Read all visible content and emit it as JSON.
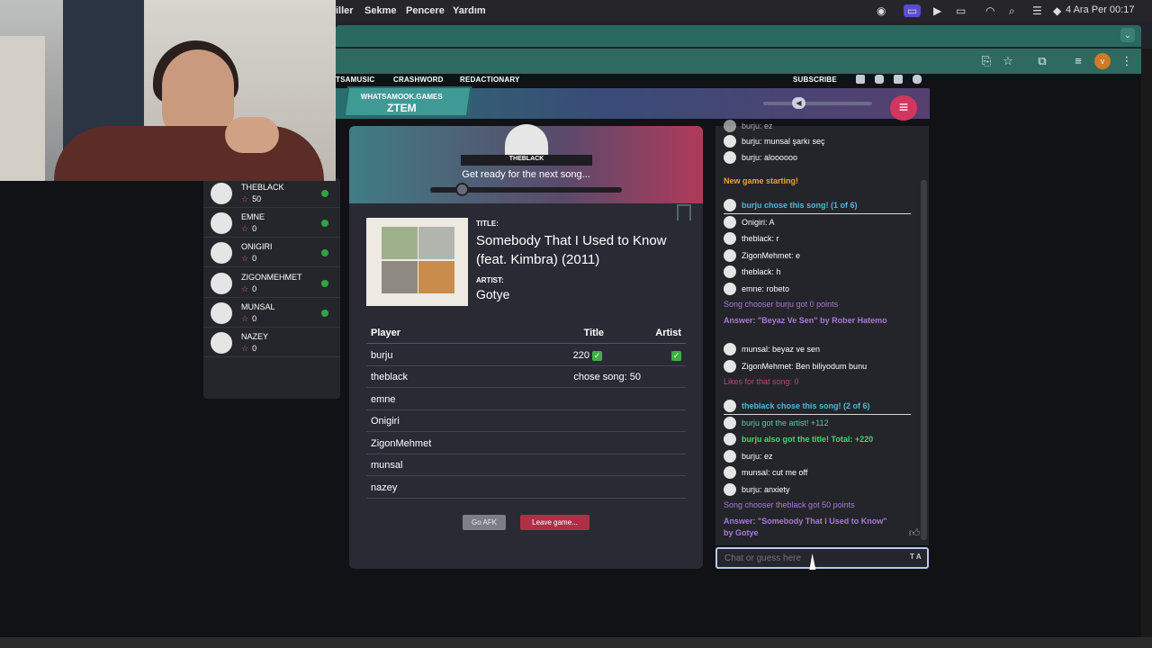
{
  "menubar": {
    "items": [
      "iller",
      "Sekme",
      "Pencere",
      "Yardım"
    ],
    "datetime": "4 Ara Per  00:17"
  },
  "site_nav": {
    "links": [
      "TSAMUSIC",
      "CRASHWORD",
      "REDACTIONARY"
    ],
    "subscribe": "SUBSCRIBE"
  },
  "logo": {
    "line1": "WHATSAMOOK.GAMES",
    "line2": "ZTEM"
  },
  "players": [
    {
      "name": "THEBLACK",
      "score": "50"
    },
    {
      "name": "EMNE",
      "score": "0"
    },
    {
      "name": "ONIGIRI",
      "score": "0"
    },
    {
      "name": "ZIGONMEHMET",
      "score": "0"
    },
    {
      "name": "MUNSAL",
      "score": "0"
    },
    {
      "name": "NAZEY",
      "score": "0"
    }
  ],
  "game": {
    "chooser": "THEBLACK",
    "status": "Get ready for the next song...",
    "title_label": "TITLE:",
    "title": "Somebody That I Used to Know (feat. Kimbra) (2011)",
    "artist_label": "ARTIST:",
    "artist": "Gotye",
    "table_headers": {
      "player": "Player",
      "title": "Title",
      "artist": "Artist"
    },
    "rows": [
      {
        "player": "burju",
        "title": "220",
        "artist": "✓"
      },
      {
        "player": "theblack",
        "title": "chose song: 50",
        "artist": ""
      },
      {
        "player": "emne",
        "title": "",
        "artist": ""
      },
      {
        "player": "Onigiri",
        "title": "",
        "artist": ""
      },
      {
        "player": "ZigonMehmet",
        "title": "",
        "artist": ""
      },
      {
        "player": "munsal",
        "title": "",
        "artist": ""
      },
      {
        "player": "nazey",
        "title": "",
        "artist": ""
      }
    ],
    "afk_label": "Go AFK",
    "leave_label": "Leave game..."
  },
  "chat": {
    "messages": [
      {
        "text": "burju: ez"
      },
      {
        "text": "burju: munsal şarkı seç"
      },
      {
        "text": "burju: aloooooo"
      },
      {
        "text": "New game starting!"
      },
      {
        "text": "burju chose this song! (1 of 6)"
      },
      {
        "text": "Onigiri: A"
      },
      {
        "text": "theblack: r"
      },
      {
        "text": "ZigonMehmet: e"
      },
      {
        "text": "theblack: h"
      },
      {
        "text": "emne: robeto"
      },
      {
        "text": "Song chooser burju got 0 points"
      },
      {
        "text": "Answer: \"Beyaz Ve Sen\" by Rober Hatemo"
      },
      {
        "text": "munsal: beyaz ve sen"
      },
      {
        "text": "ZigonMehmet: Ben biliyodum bunu"
      },
      {
        "text": "Likes for that song: 0"
      },
      {
        "text": "theblack chose this song! (2 of 6)"
      },
      {
        "text": "burju got the artist! +112"
      },
      {
        "text": "burju also got the title! Total: +220"
      },
      {
        "text": "burju: ez"
      },
      {
        "text": "munsal: cut me off"
      },
      {
        "text": "burju: anxiety"
      },
      {
        "text": "Song chooser theblack got 50 points"
      },
      {
        "text": "Answer: \"Somebody That I Used to Know\" by Gotye"
      }
    ],
    "input_placeholder": "Chat or guess here",
    "translate_tag": "T A"
  }
}
